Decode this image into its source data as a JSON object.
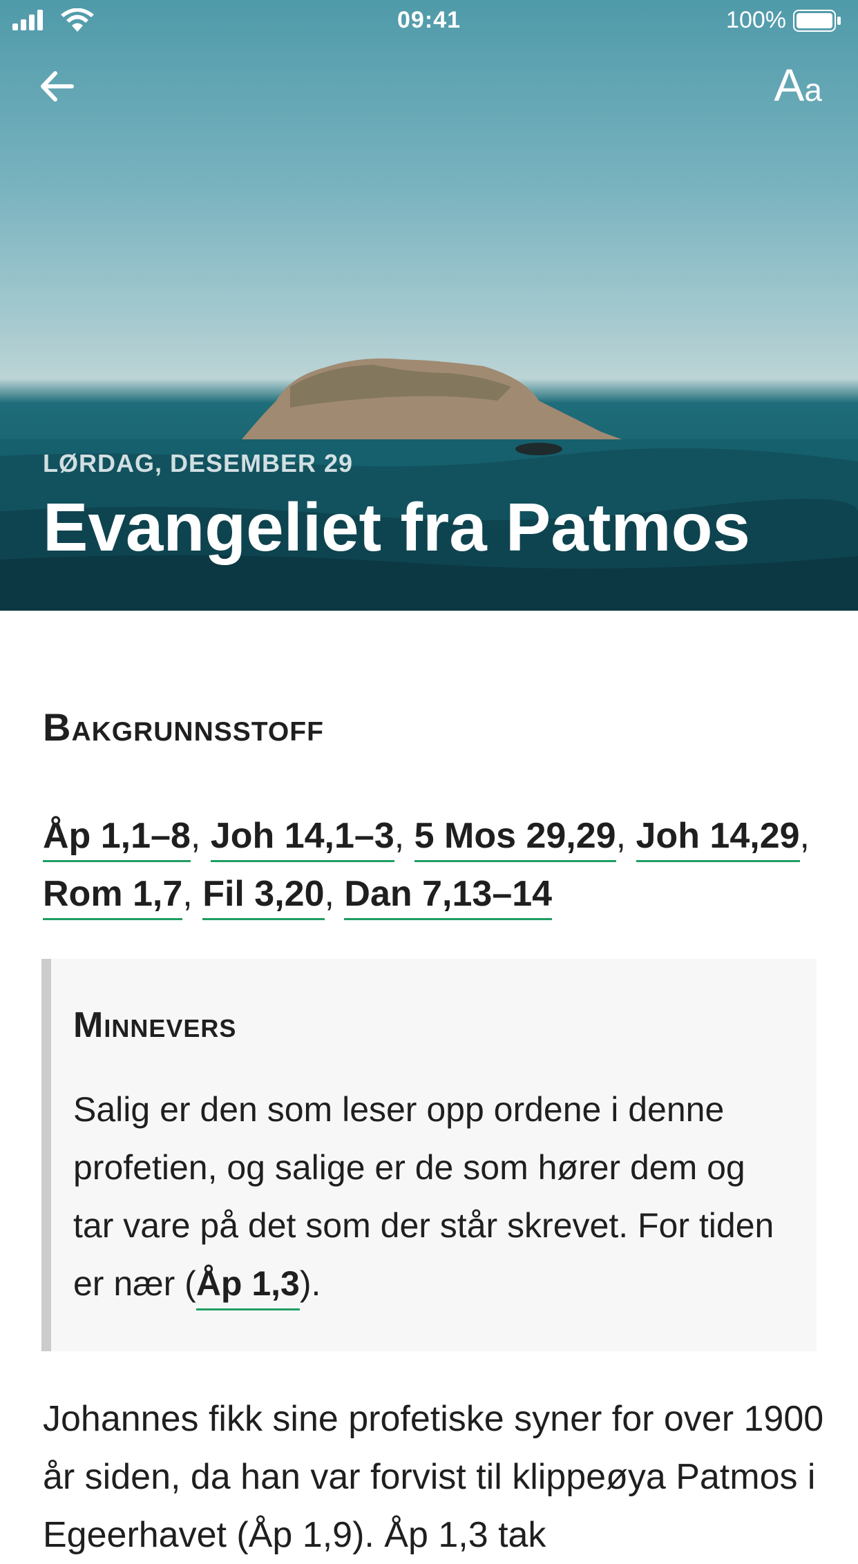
{
  "status_bar": {
    "time": "09:41",
    "battery_percent": "100%",
    "icons": [
      "signal-icon",
      "wifi-icon",
      "battery-icon"
    ]
  },
  "header": {
    "back_icon": "arrow-left-icon",
    "font_size_label_large": "A",
    "font_size_label_small": "a",
    "date": "LØRDAG, DESEMBER 29",
    "title": "Evangeliet fra Patmos"
  },
  "background": {
    "heading": "Bakgrunnsstoff",
    "refs": [
      "Åp 1,1–8",
      "Joh 14,1–3",
      "5 Mos 29,29",
      "Joh 14,29",
      "Rom 1,7",
      "Fil 3,20",
      "Dan 7,13–14"
    ]
  },
  "memory_verse": {
    "heading": "Minnevers",
    "text": "Salig er den som leser opp ordene i denne profetien, og salige er de som hører dem og tar vare på det som der står skrevet. For tiden er nær (",
    "ref": "Åp 1,3",
    "text_after": ")."
  },
  "body": {
    "text": "Johannes fikk sine profetiske syner for over 1900 år siden, da han var forvist til klippeøya Patmos i Egeerhavet (Åp 1,9). Åp 1,3 tak"
  },
  "colors": {
    "link_underline": "#1e9e62",
    "quote_bar": "#cccccc",
    "quote_bg": "#f7f7f7"
  }
}
